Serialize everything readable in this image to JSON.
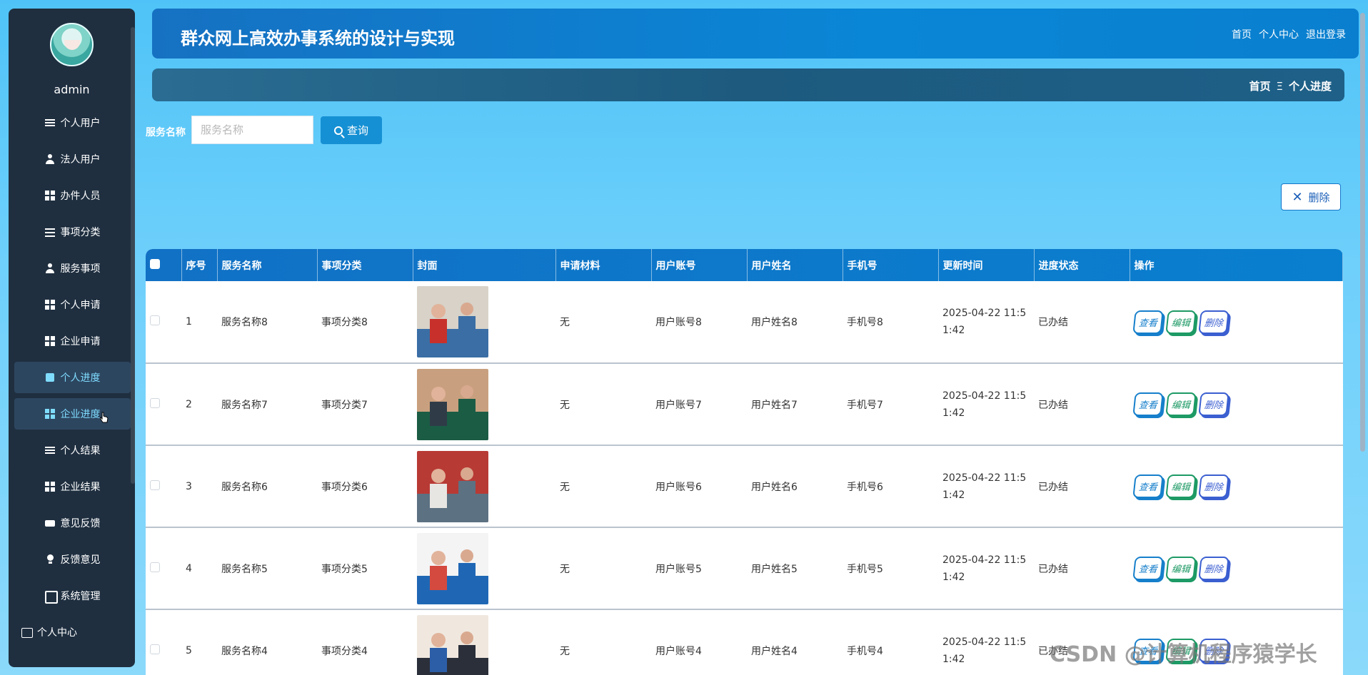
{
  "sidebar": {
    "username": "admin",
    "items": [
      {
        "label": "个人用户",
        "icon": "list-icon"
      },
      {
        "label": "法人用户",
        "icon": "user-icon"
      },
      {
        "label": "办件人员",
        "icon": "grid-icon"
      },
      {
        "label": "事项分类",
        "icon": "sliders-icon"
      },
      {
        "label": "服务事项",
        "icon": "user-icon"
      },
      {
        "label": "个人申请",
        "icon": "grid-icon"
      },
      {
        "label": "企业申请",
        "icon": "grid-icon"
      },
      {
        "label": "个人进度",
        "icon": "book-icon"
      },
      {
        "label": "企业进度",
        "icon": "grid-icon"
      },
      {
        "label": "个人结果",
        "icon": "list-icon"
      },
      {
        "label": "企业结果",
        "icon": "grid-icon"
      },
      {
        "label": "意见反馈",
        "icon": "ticket-icon"
      },
      {
        "label": "反馈意见",
        "icon": "bulb-icon"
      },
      {
        "label": "系统管理",
        "icon": "chart-icon"
      },
      {
        "label": "个人中心",
        "icon": "card-icon"
      }
    ]
  },
  "header": {
    "title": "群众网上高效办事系统的设计与实现",
    "links": [
      "首页",
      "个人中心",
      "退出登录"
    ]
  },
  "breadcrumb": {
    "home": "首页",
    "separator": "Ξ",
    "current": "个人进度"
  },
  "search": {
    "label": "服务名称",
    "placeholder": "服务名称",
    "button": "查询"
  },
  "toolbar": {
    "delete_label": "删除"
  },
  "table": {
    "columns": [
      "序号",
      "服务名称",
      "事项分类",
      "封面",
      "申请材料",
      "用户账号",
      "用户姓名",
      "手机号",
      "更新时间",
      "进度状态",
      "操作"
    ],
    "rows": [
      {
        "no": "1",
        "service": "服务名称8",
        "category": "事项分类8",
        "material": "无",
        "account": "用户账号8",
        "name": "用户姓名8",
        "phone": "手机号8",
        "time": "2025-04-22 11:51:42",
        "status": "已办结"
      },
      {
        "no": "2",
        "service": "服务名称7",
        "category": "事项分类7",
        "material": "无",
        "account": "用户账号7",
        "name": "用户姓名7",
        "phone": "手机号7",
        "time": "2025-04-22 11:51:42",
        "status": "已办结"
      },
      {
        "no": "3",
        "service": "服务名称6",
        "category": "事项分类6",
        "material": "无",
        "account": "用户账号6",
        "name": "用户姓名6",
        "phone": "手机号6",
        "time": "2025-04-22 11:51:42",
        "status": "已办结"
      },
      {
        "no": "4",
        "service": "服务名称5",
        "category": "事项分类5",
        "material": "无",
        "account": "用户账号5",
        "name": "用户姓名5",
        "phone": "手机号5",
        "time": "2025-04-22 11:51:42",
        "status": "已办结"
      },
      {
        "no": "5",
        "service": "服务名称4",
        "category": "事项分类4",
        "material": "无",
        "account": "用户账号4",
        "name": "用户姓名4",
        "phone": "手机号4",
        "time": "2025-04-22 11:51:42",
        "status": "已办结"
      }
    ],
    "ops": {
      "view": "查看",
      "edit": "编辑",
      "delete": "删除"
    }
  },
  "watermark": "CSDN @计算机程序猿学长",
  "colors": {
    "accent": "#0a86d6",
    "sidebar": "#1f2f40",
    "active_text": "#7fdcff"
  }
}
